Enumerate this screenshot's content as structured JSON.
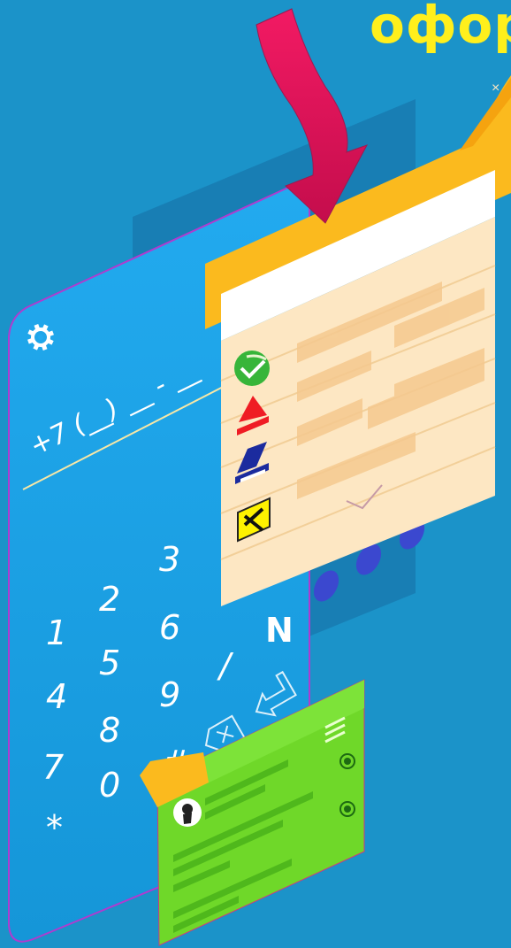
{
  "headline": "офор",
  "phone": {
    "mask": "+7 (__) __ - __",
    "keys": [
      "1",
      "2",
      "3",
      "4",
      "5",
      "6",
      "7",
      "8",
      "9",
      "*",
      "0",
      "#",
      "/",
      "N"
    ]
  },
  "form_window": {
    "close_glyph": "×",
    "submit_glyph": "✓",
    "logos": [
      "sberbank-logo-icon",
      "alfabank-logo-icon",
      "vtb-logo-icon",
      "raiffeisen-logo-icon"
    ]
  },
  "widget": {
    "menu_icon": "hamburger-icon",
    "avatar_icon": "user-avatar-icon"
  },
  "colors": {
    "background": "#1b93c9",
    "headline": "#ffef1c",
    "phone_panel": "#1ea5e6",
    "form_body": "#fde7c3",
    "form_header": "#fbba1e",
    "arrow": "#e0115a",
    "widget": "#6fd829",
    "dots": "#3b48cf"
  }
}
